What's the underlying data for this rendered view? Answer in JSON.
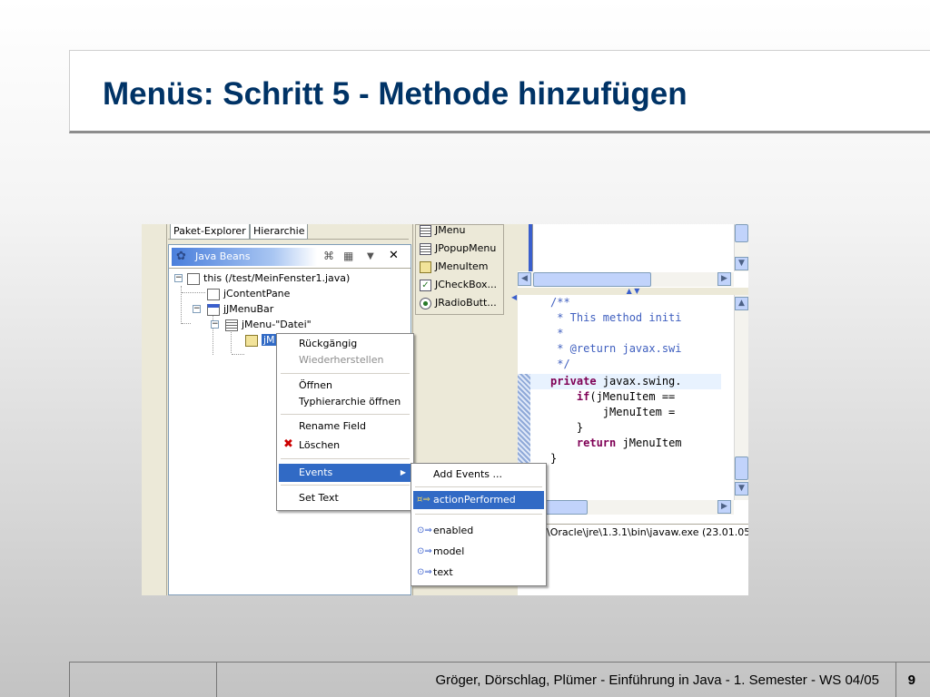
{
  "slide": {
    "title": "Menüs: Schritt 5 - Methode hinzufügen",
    "footer_text": "Gröger, Dörschlag, Plümer -  Einführung in Java  -  1. Semester  -  WS 04/05",
    "page_number": "9"
  },
  "colors": {
    "title": "#003366",
    "selection": "#316ac5",
    "java_comment": "#3f5fbf",
    "java_keyword": "#7f0055"
  },
  "explorer": {
    "tabs": [
      "Paket-Explorer",
      "Hierarchie"
    ],
    "view_title": "Java Beans",
    "view_icons": [
      "beans-icon",
      "collapse-icon",
      "view-menu-icon",
      "close-icon"
    ],
    "tree": [
      {
        "label": "this (/test/MeinFenster1.java)",
        "expander": "−"
      },
      {
        "label": "jContentPane",
        "expander": ""
      },
      {
        "label": "jJMenuBar",
        "expander": "−"
      },
      {
        "label": "jMenu-\"Datei\"",
        "expander": "−"
      },
      {
        "label": "jM",
        "expander": ""
      }
    ]
  },
  "palette": {
    "items": [
      "JMenu",
      "JPopupMenu",
      "JMenuItem",
      "JCheckBox...",
      "JRadioButt..."
    ]
  },
  "editor": {
    "code": [
      "/**",
      " * This method initi",
      " *",
      " * @return javax.swi",
      " */",
      "private javax.swing.",
      "    if(jMenuItem == ",
      "        jMenuItem = ",
      "    }",
      "    return jMenuItem",
      "}"
    ],
    "keywords": {
      "private": "private",
      "if": "if",
      "return": "return"
    },
    "code_rest": {
      "private": " javax.swing.",
      "if": "(jMenuItem == ",
      "return": " jMenuItem"
    }
  },
  "console": {
    "text": "\\Oracle\\jre\\1.3.1\\bin\\javaw.exe (23.01.05"
  },
  "context_menu": {
    "items": [
      {
        "label": "Rückgängig",
        "enabled": true
      },
      {
        "label": "Wiederherstellen",
        "enabled": false
      },
      {
        "label": "Öffnen",
        "enabled": true
      },
      {
        "label": "Typhierarchie öffnen",
        "enabled": true
      },
      {
        "label": "Rename Field",
        "enabled": true
      },
      {
        "label": "Löschen",
        "enabled": true,
        "icon": "delete-icon"
      },
      {
        "label": "Events",
        "enabled": true,
        "selected": true,
        "submenu": true
      },
      {
        "label": "Set Text",
        "enabled": true
      }
    ]
  },
  "events_submenu": {
    "items": [
      {
        "label": "Add Events ...",
        "selected": false
      },
      {
        "label": "actionPerformed",
        "selected": true,
        "icon": "event-icon"
      },
      {
        "label": "enabled",
        "selected": false,
        "icon": "property-icon"
      },
      {
        "label": "model",
        "selected": false,
        "icon": "property-icon"
      },
      {
        "label": "text",
        "selected": false,
        "icon": "property-icon"
      }
    ]
  }
}
